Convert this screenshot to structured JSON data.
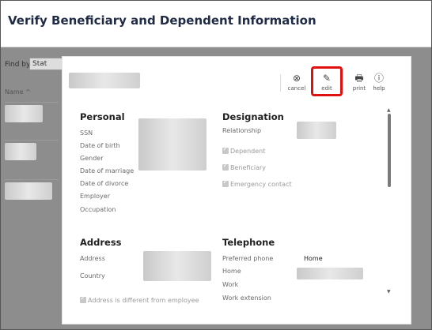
{
  "page": {
    "title": "Verify Beneficiary and Dependent Information"
  },
  "background": {
    "find_by_label": "Find by",
    "find_by_value": "Stat",
    "name_column": "Name ^"
  },
  "toolbar": {
    "cancel": {
      "label": "cancel",
      "icon": "cancel-icon"
    },
    "edit": {
      "label": "edit",
      "icon": "pencil-icon"
    },
    "print": {
      "label": "print",
      "icon": "printer-icon"
    },
    "help": {
      "label": "help",
      "icon": "help-icon"
    },
    "highlight_color": "#e01010"
  },
  "personal": {
    "heading": "Personal",
    "fields": [
      "SSN",
      "Date of birth",
      "Gender",
      "Date of marriage",
      "Date of divorce",
      "Employer",
      "Occupation"
    ]
  },
  "designation": {
    "heading": "Designation",
    "relationship_label": "Relationship",
    "checkboxes": [
      "Dependent",
      "Beneficiary",
      "Emergency contact"
    ]
  },
  "address": {
    "heading": "Address",
    "address_label": "Address",
    "country_label": "Country",
    "different_checkbox": "Address is different from employee"
  },
  "telephone": {
    "heading": "Telephone",
    "preferred_label": "Preferred phone",
    "preferred_value": "Home",
    "home_label": "Home",
    "work_label": "Work",
    "work_ext_label": "Work extension"
  }
}
